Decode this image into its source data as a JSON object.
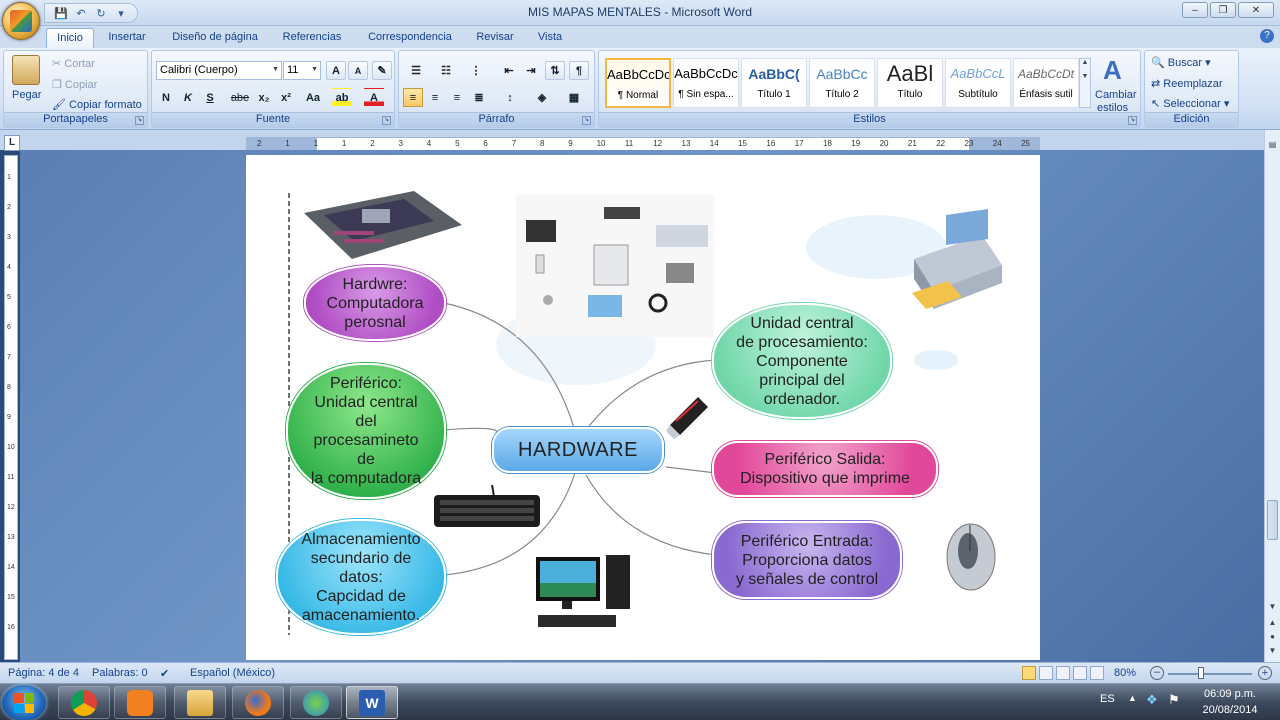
{
  "window": {
    "title": "MIS MAPAS MENTALES - Microsoft Word",
    "controls": [
      "–",
      "❐",
      "✕"
    ]
  },
  "tabs": [
    {
      "label": "Inicio",
      "active": true
    },
    {
      "label": "Insertar"
    },
    {
      "label": "Diseño de página"
    },
    {
      "label": "Referencias"
    },
    {
      "label": "Correspondencia"
    },
    {
      "label": "Revisar"
    },
    {
      "label": "Vista"
    }
  ],
  "ribbon": {
    "portapapeles": {
      "label": "Portapapeles",
      "paste": "Pegar",
      "cut": "Cortar",
      "copy": "Copiar",
      "format_painter": "Copiar formato"
    },
    "fuente": {
      "label": "Fuente",
      "font_name": "Calibri (Cuerpo)",
      "font_size": "11",
      "bold": "N",
      "italic": "K",
      "underline": "S",
      "strike": "abe",
      "subscript": "x₂",
      "superscript": "x²",
      "case": "Aa",
      "grow": "A",
      "shrink": "A"
    },
    "parrafo": {
      "label": "Párrafo"
    },
    "estilos": {
      "label": "Estilos",
      "items": [
        {
          "preview": "AaBbCcDc",
          "name": "¶ Normal",
          "selected": true
        },
        {
          "preview": "AaBbCcDc",
          "name": "¶ Sin espa..."
        },
        {
          "preview": "AaBbC(",
          "name": "Título 1"
        },
        {
          "preview": "AaBbCc",
          "name": "Título 2"
        },
        {
          "preview": "AaBl",
          "name": "Título"
        },
        {
          "preview": "AaBbCcL",
          "name": "Subtítulo"
        },
        {
          "preview": "AaBbCcDt",
          "name": "Énfasis sutil"
        }
      ],
      "change_styles_line1": "Cambiar",
      "change_styles_line2": "estilos"
    },
    "edicion": {
      "label": "Edición",
      "find": "Buscar",
      "replace": "Reemplazar",
      "select": "Seleccionar"
    }
  },
  "ruler": {
    "numbers": [
      "2",
      "1",
      "1",
      "1",
      "2",
      "3",
      "4",
      "5",
      "6",
      "7",
      "8",
      "9",
      "10",
      "11",
      "12",
      "13",
      "14",
      "15",
      "16",
      "17",
      "18",
      "19",
      "20",
      "21",
      "22",
      "23",
      "24",
      "25"
    ],
    "vnumbers": [
      "1",
      "2",
      "3",
      "4",
      "5",
      "6",
      "7",
      "8",
      "9",
      "10",
      "11",
      "12",
      "13",
      "14",
      "15",
      "16"
    ]
  },
  "mindmap": {
    "center": "HARDWARE",
    "nodes": {
      "hardware_def": [
        "Hardwre:",
        "Computadora",
        "perosnal"
      ],
      "periferico_cpu": [
        "Periférico:",
        "Unidad central",
        "del",
        "procesamineto",
        "de",
        "la computadora"
      ],
      "almacenamiento": [
        "Almacenamiento",
        "secundario de",
        "datos:",
        "Capcidad de",
        "amacenamiento."
      ],
      "cpu": [
        "Unidad central",
        "de procesamiento:",
        "Componente",
        "principal del",
        "ordenador."
      ],
      "salida": [
        "Periférico Salida:",
        "Dispositivo que imprime"
      ],
      "entrada": [
        "Periférico Entrada:",
        "Proporciona datos",
        "y señales de control"
      ]
    },
    "colors": {
      "purple": "#b04cc4",
      "green": "#2fb04a",
      "cyan": "#36b8e6",
      "mint": "#6fd6a8",
      "pink": "#e2489a",
      "violet": "#8a6ad0",
      "center": "#5aa8e8"
    }
  },
  "status": {
    "page": "Página: 4 de 4",
    "words": "Palabras: 0",
    "language": "Español (México)",
    "zoom": "80%"
  },
  "taskbar": {
    "lang": "ES",
    "time": "06:09 p.m.",
    "date": "20/08/2014"
  }
}
